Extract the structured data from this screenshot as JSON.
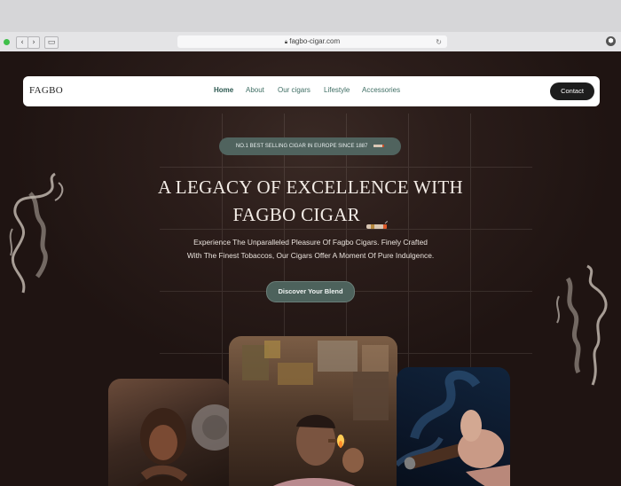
{
  "browser": {
    "url": "fagbo-cigar.com",
    "back_icon": "chevron-left-icon",
    "forward_icon": "chevron-right-icon",
    "sidebar_icon": "sidebar-icon",
    "reload_icon": "reload-icon",
    "extension_icon": "extension-icon"
  },
  "navbar": {
    "logo": "FAGBO",
    "links": [
      {
        "label": "Home",
        "active": true
      },
      {
        "label": "About",
        "active": false
      },
      {
        "label": "Our cigars",
        "active": false
      },
      {
        "label": "Lifestyle",
        "active": false
      },
      {
        "label": "Accessories",
        "active": false
      }
    ],
    "contact_label": "Contact"
  },
  "hero": {
    "badge": "NO.1 BEST SELLING CIGAR IN EUROPE SINCE 1887",
    "title_line1": "A LEGACY OF EXCELLENCE WITH",
    "title_line2": "FAGBO CIGAR",
    "subtitle_line1": "Experience The Unparalleled Pleasure Of Fagbo Cigars.  Finely Crafted",
    "subtitle_line2": "With The Finest Tobaccos, Our Cigars Offer A Moment Of Pure Indulgence.",
    "cta_label": "Discover Your Blend"
  },
  "colors": {
    "accent": "#4d625c",
    "background": "#2b1d1a",
    "nav_link": "#3f6e64"
  }
}
